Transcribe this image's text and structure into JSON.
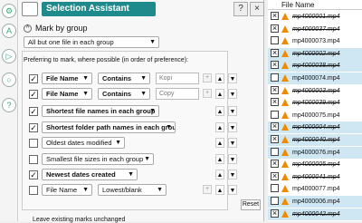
{
  "window": {
    "title": "Selection Assistant"
  },
  "mark_by_group": {
    "label": "Mark by group",
    "scope": "All but one file in each group",
    "preference_label": "Preferring to mark, where possible (in order of preference):"
  },
  "criteria": [
    {
      "checked": true,
      "field": "File Name",
      "op": "Contains",
      "value": "Kopi"
    },
    {
      "checked": true,
      "field": "File Name",
      "op": "Contains",
      "value": "Copy"
    },
    {
      "checked": true,
      "field": "Shortest file names in each group"
    },
    {
      "checked": true,
      "field": "Shortest folder path names in each group"
    },
    {
      "checked": false,
      "field": "Oldest dates modified"
    },
    {
      "checked": false,
      "field": "Smallest file sizes in each group"
    },
    {
      "checked": true,
      "field": "Newest dates created"
    },
    {
      "checked": false,
      "field": "File Name",
      "op": "Lowest/blank"
    }
  ],
  "buttons": {
    "reset": "Reset",
    "help": "?",
    "close": "×"
  },
  "bottom_text": "Leave existing marks unchanged",
  "list": {
    "header": "File Name",
    "rows": [
      {
        "name": "mp4000001.mp4",
        "marked": true,
        "selected": false
      },
      {
        "name": "mp4000037.mp4",
        "marked": true,
        "selected": false
      },
      {
        "name": "mp4000073.mp4",
        "marked": false,
        "selected": false
      },
      {
        "name": "mp4000002.mp4",
        "marked": true,
        "selected": true
      },
      {
        "name": "mp4000038.mp4",
        "marked": true,
        "selected": true
      },
      {
        "name": "mp4000074.mp4",
        "marked": false,
        "selected": true
      },
      {
        "name": "mp4000003.mp4",
        "marked": true,
        "selected": false
      },
      {
        "name": "mp4000039.mp4",
        "marked": true,
        "selected": false
      },
      {
        "name": "mp4000075.mp4",
        "marked": false,
        "selected": false
      },
      {
        "name": "mp4000004.mp4",
        "marked": true,
        "selected": true
      },
      {
        "name": "mp4000040.mp4",
        "marked": true,
        "selected": true
      },
      {
        "name": "mp4000076.mp4",
        "marked": false,
        "selected": true
      },
      {
        "name": "mp4000005.mp4",
        "marked": true,
        "selected": false
      },
      {
        "name": "mp4000041.mp4",
        "marked": true,
        "selected": false
      },
      {
        "name": "mp4000077.mp4",
        "marked": false,
        "selected": false
      },
      {
        "name": "mp4000006.mp4",
        "marked": false,
        "selected": true
      },
      {
        "name": "mp4000042.mp4",
        "marked": true,
        "selected": true
      }
    ]
  }
}
